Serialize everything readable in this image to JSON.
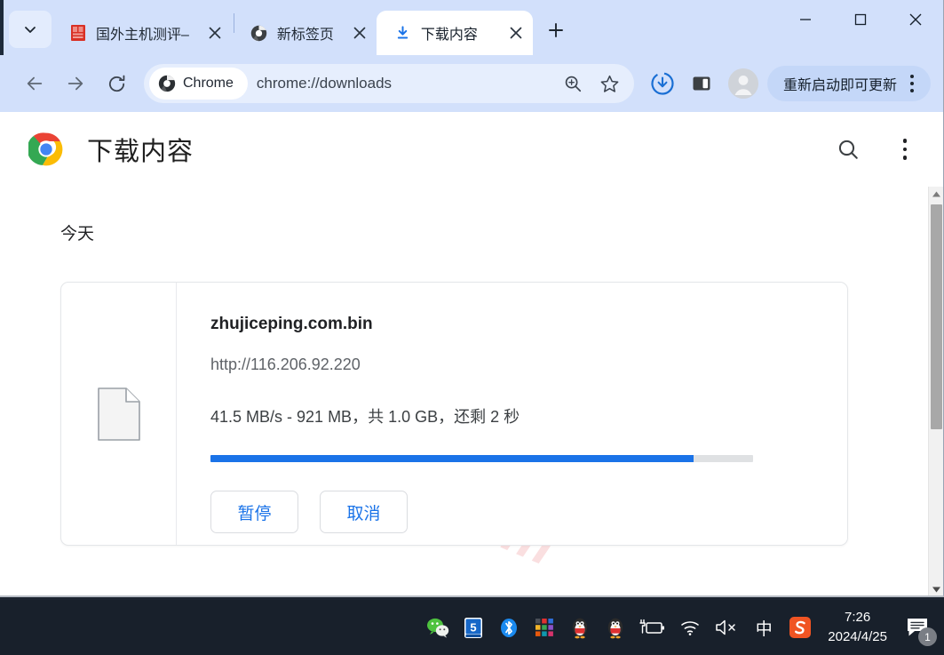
{
  "window": {
    "controls": {
      "minimize": "—",
      "maximize": "▢",
      "close": "✕"
    }
  },
  "tabstrip": {
    "tab_search_icon": "chevron-down-icon",
    "new_tab_label": "+",
    "tabs": [
      {
        "title": "国外主机测评–",
        "favicon": "site-favicon-red",
        "close": "✕",
        "active": false
      },
      {
        "title": "新标签页",
        "favicon": "chrome-grey-icon",
        "close": "✕",
        "active": false
      },
      {
        "title": "下载内容",
        "favicon": "download-blue-icon",
        "close": "✕",
        "active": true
      }
    ]
  },
  "toolbar": {
    "back": "←",
    "forward": "→",
    "reload": "⟳",
    "chrome_chip_label": "Chrome",
    "url": "chrome://downloads",
    "zoom_icon": "zoom-search-icon",
    "bookmark_icon": "star-icon",
    "downloads_icon": "download-progress-icon",
    "side_panel_icon": "side-panel-icon",
    "profile_icon": "avatar-icon",
    "update_label": "重新启动即可更新",
    "menu_icon": "three-dot-menu-icon"
  },
  "page": {
    "title": "下载内容",
    "logo": "chrome-logo",
    "search_icon": "search-icon",
    "menu_icon": "three-dot-menu-icon",
    "watermark": "zhujiceping.com",
    "section_label": "今天",
    "download": {
      "file_icon": "generic-file-icon",
      "file_name": "zhujiceping.com.bin",
      "url": "http://116.206.92.220",
      "status": "41.5 MB/s - 921 MB，共 1.0 GB，还剩 2 秒",
      "progress_percent": 89,
      "progress_color": "#1a73e8",
      "pause_label": "暂停",
      "cancel_label": "取消"
    },
    "scrollbar": {
      "up": "▲",
      "down": "▼"
    }
  },
  "taskbar": {
    "tray": [
      {
        "name": "wechat-icon"
      },
      {
        "name": "video-player-5-icon"
      },
      {
        "name": "bluetooth-icon"
      },
      {
        "name": "color-squares-icon"
      },
      {
        "name": "qq-penguin-icon"
      },
      {
        "name": "qq-penguin-2-icon"
      },
      {
        "name": "battery-charging-icon"
      },
      {
        "name": "wifi-icon"
      },
      {
        "name": "volume-muted-icon"
      },
      {
        "name": "ime-chinese-icon",
        "glyph": "中"
      },
      {
        "name": "sogou-input-icon",
        "glyph": "S"
      }
    ],
    "time": "7:26",
    "date": "2024/4/25",
    "notification_icon": "notification-icon",
    "notification_count": "1"
  }
}
